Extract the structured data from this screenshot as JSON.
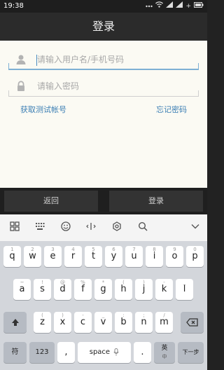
{
  "status_bar": {
    "time": "19:38",
    "battery_label": "+"
  },
  "title_bar": {
    "title": "登录"
  },
  "login_form": {
    "username_placeholder": "请输入用户名/手机号码",
    "password_placeholder": "请输入密码",
    "get_test_account_link": "获取测试帐号",
    "forgot_password_link": "忘记密码"
  },
  "button_bar": {
    "back_label": "返回",
    "login_label": "登录"
  },
  "keyboard": {
    "toolbar_icons": [
      "grid-icon",
      "dots-grid-icon",
      "emoji-icon",
      "cursor-icon",
      "settings-icon",
      "search-icon",
      "collapse-icon"
    ],
    "row1": [
      {
        "key": "q",
        "hint": "1"
      },
      {
        "key": "w",
        "hint": "2"
      },
      {
        "key": "e",
        "hint": "3"
      },
      {
        "key": "r",
        "hint": "4"
      },
      {
        "key": "t",
        "hint": "5"
      },
      {
        "key": "y",
        "hint": "6"
      },
      {
        "key": "u",
        "hint": "7"
      },
      {
        "key": "i",
        "hint": "8"
      },
      {
        "key": "o",
        "hint": "9"
      },
      {
        "key": "p",
        "hint": "0"
      }
    ],
    "row2": [
      {
        "key": "a",
        "hint": "~"
      },
      {
        "key": "s",
        "hint": "!"
      },
      {
        "key": "d",
        "hint": "@"
      },
      {
        "key": "f",
        "hint": "%"
      },
      {
        "key": "g",
        "hint": "*"
      },
      {
        "key": "h",
        "hint": "("
      },
      {
        "key": "j",
        "hint": ")"
      },
      {
        "key": "k",
        "hint": "-"
      },
      {
        "key": "l",
        "hint": "_"
      }
    ],
    "row3": [
      {
        "key": "z",
        "hint": "("
      },
      {
        "key": "x",
        "hint": ")"
      },
      {
        "key": "c",
        "hint": "-"
      },
      {
        "key": "v",
        "hint": "_"
      },
      {
        "key": "b",
        "hint": ":"
      },
      {
        "key": "n",
        "hint": ";"
      },
      {
        "key": "m",
        "hint": "/"
      }
    ],
    "symbol_key": "符",
    "numeric_key": "123",
    "comma_key": ",",
    "space_key": "space",
    "period_key": ".",
    "lang_key_top": "英",
    "lang_key_bottom": "中",
    "next_key": "下一步"
  }
}
